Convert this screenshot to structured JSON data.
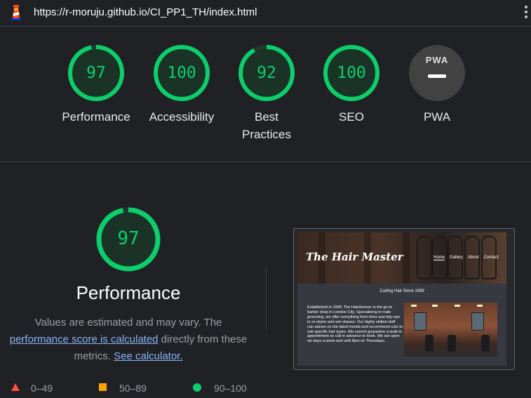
{
  "header": {
    "url": "https://r-moruju.github.io/CI_PP1_TH/index.html"
  },
  "categories": [
    {
      "label": "Performance",
      "score": "97",
      "value": 97
    },
    {
      "label": "Accessibility",
      "score": "100",
      "value": 100
    },
    {
      "label": "Best Practices",
      "score": "92",
      "value": 92
    },
    {
      "label": "SEO",
      "score": "100",
      "value": 100
    },
    {
      "label": "PWA",
      "badge": "PWA"
    }
  ],
  "performance": {
    "score": "97",
    "value": 97,
    "title": "Performance",
    "desc_1": "Values are estimated and may vary. The ",
    "desc_link_1": "performance score is calculated",
    "desc_2": " directly from these metrics. ",
    "desc_link_2": "See calculator."
  },
  "legend": [
    {
      "range": "0–49",
      "color": "#ff4e42"
    },
    {
      "range": "50–89",
      "color": "#ffa400"
    },
    {
      "range": "90–100",
      "color": "#0cce6b"
    }
  ],
  "screenshot": {
    "logo": "The Hair Master",
    "nav": [
      "Home",
      "Gallery",
      "About",
      "Contact"
    ],
    "subtitle": "Cutting Hair Since 1999",
    "body": "Established in 1999, The Hairdresser is the go-to barber shop in London City. Specialising in male grooming, we offer everything from trims and tidy-ups to re-styles and wet shaves. Our highly skilled staff can advise on the latest trends and recommend cuts to suit specific hair types. We cannot guarantee a walk-in appointment so call in advance to book. We are open six days a week and until 8pm on Thursdays."
  },
  "colors": {
    "pass": "#0cce6b",
    "pass_bg": "#1f3a2a",
    "link": "#8ab4f8",
    "background": "#202124"
  }
}
